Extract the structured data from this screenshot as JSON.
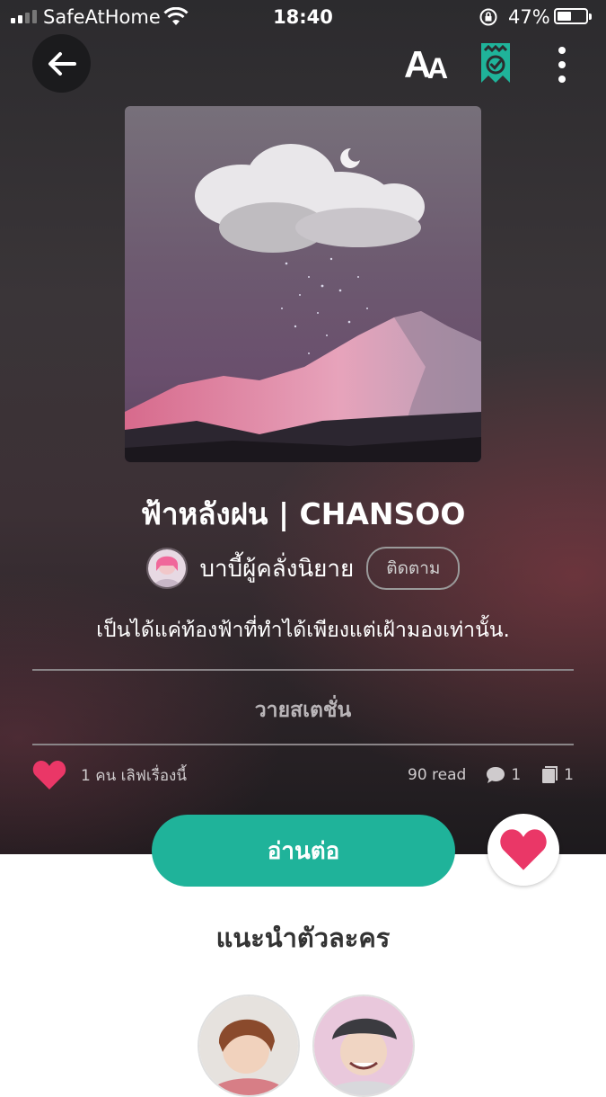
{
  "status_bar": {
    "carrier": "SafeAtHome",
    "time": "18:40",
    "battery": "47%"
  },
  "icons": {
    "back": "arrow-left-icon",
    "font_size": "text-size-icon",
    "library": "library-added-icon",
    "more": "more-vertical-icon",
    "heart": "heart-icon",
    "comment": "comment-icon",
    "chapters": "book-icon"
  },
  "colors": {
    "accent": "#1fb39a",
    "heart": "#ea3767"
  },
  "story": {
    "title": "ฟ้าหลังฝน | CHANSOO",
    "author": "บาบี้ผู้คลั่งนิยาย",
    "follow_label": "ติดตาม",
    "tagline": "เป็นได้แค่ท้องฟ้าที่ทำได้เพียงแต่เฝ้ามองเท่านั้น.",
    "genre": "วายสเตชั่น"
  },
  "stats": {
    "likes_text": "1 คน เลิฟเรื่องนี้",
    "reads": "90 read",
    "comments": "1",
    "chapters": "1"
  },
  "actions": {
    "read_label": "อ่านต่อ"
  },
  "characters": {
    "section_title": "แนะนำตัวละคร"
  }
}
